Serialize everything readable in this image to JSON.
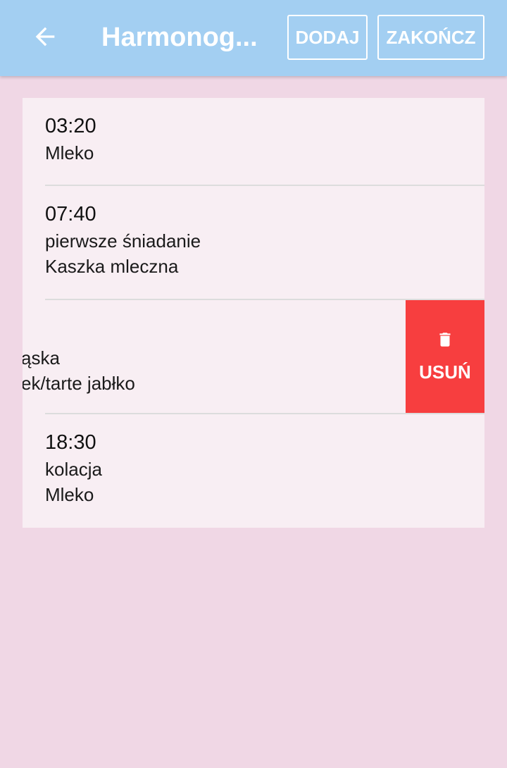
{
  "appbar": {
    "back_icon": "arrow-left-icon",
    "title": "Harmonog...",
    "add_label": "DODAJ",
    "finish_label": "ZAKOŃCZ"
  },
  "schedule": {
    "items": [
      {
        "time": "03:20",
        "lines": [
          "Mleko"
        ]
      },
      {
        "time": "07:40",
        "lines": [
          "pierwsze śniadanie",
          "Kaszka mleczna"
        ]
      },
      {
        "time": "",
        "lines": [
          "ąska",
          "ek/tarte jabłko"
        ]
      },
      {
        "time": "18:30",
        "lines": [
          "kolacja",
          "Mleko"
        ]
      }
    ],
    "delete_label": "USUŃ",
    "delete_icon": "trash-icon"
  },
  "colors": {
    "appbar": "#a3cff2",
    "background": "#f0d7e5",
    "list": "#f8eef3",
    "delete": "#f73e3f"
  }
}
